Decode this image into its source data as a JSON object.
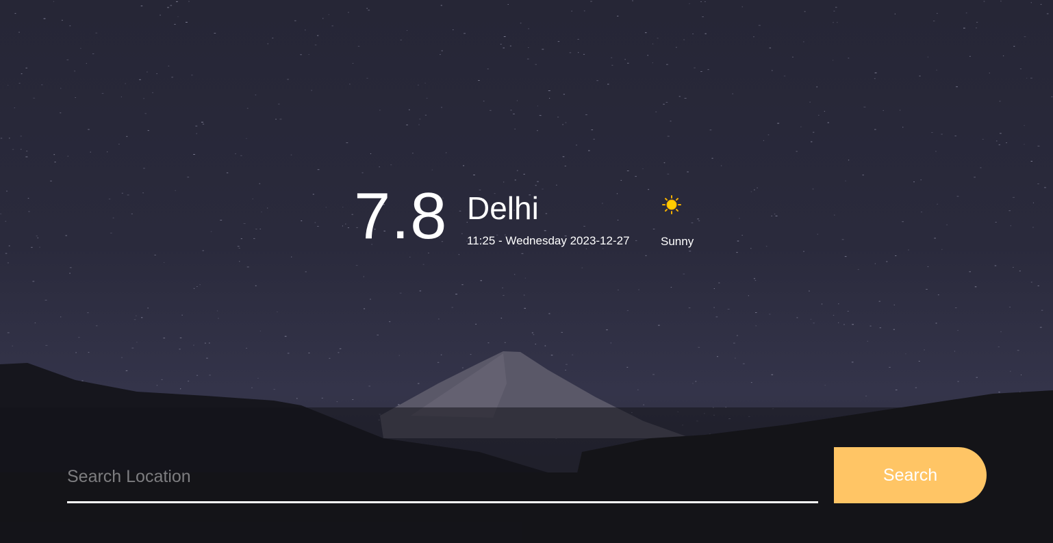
{
  "weather": {
    "temperature": "7.8",
    "city": "Delhi",
    "datetime": "11:25 - Wednesday 2023-12-27",
    "condition": "Sunny",
    "condition_icon": "sun-icon"
  },
  "search": {
    "placeholder": "Search Location",
    "value": "",
    "button_label": "Search"
  },
  "colors": {
    "accent": "#ffc565",
    "sun": "#ffcc00"
  }
}
